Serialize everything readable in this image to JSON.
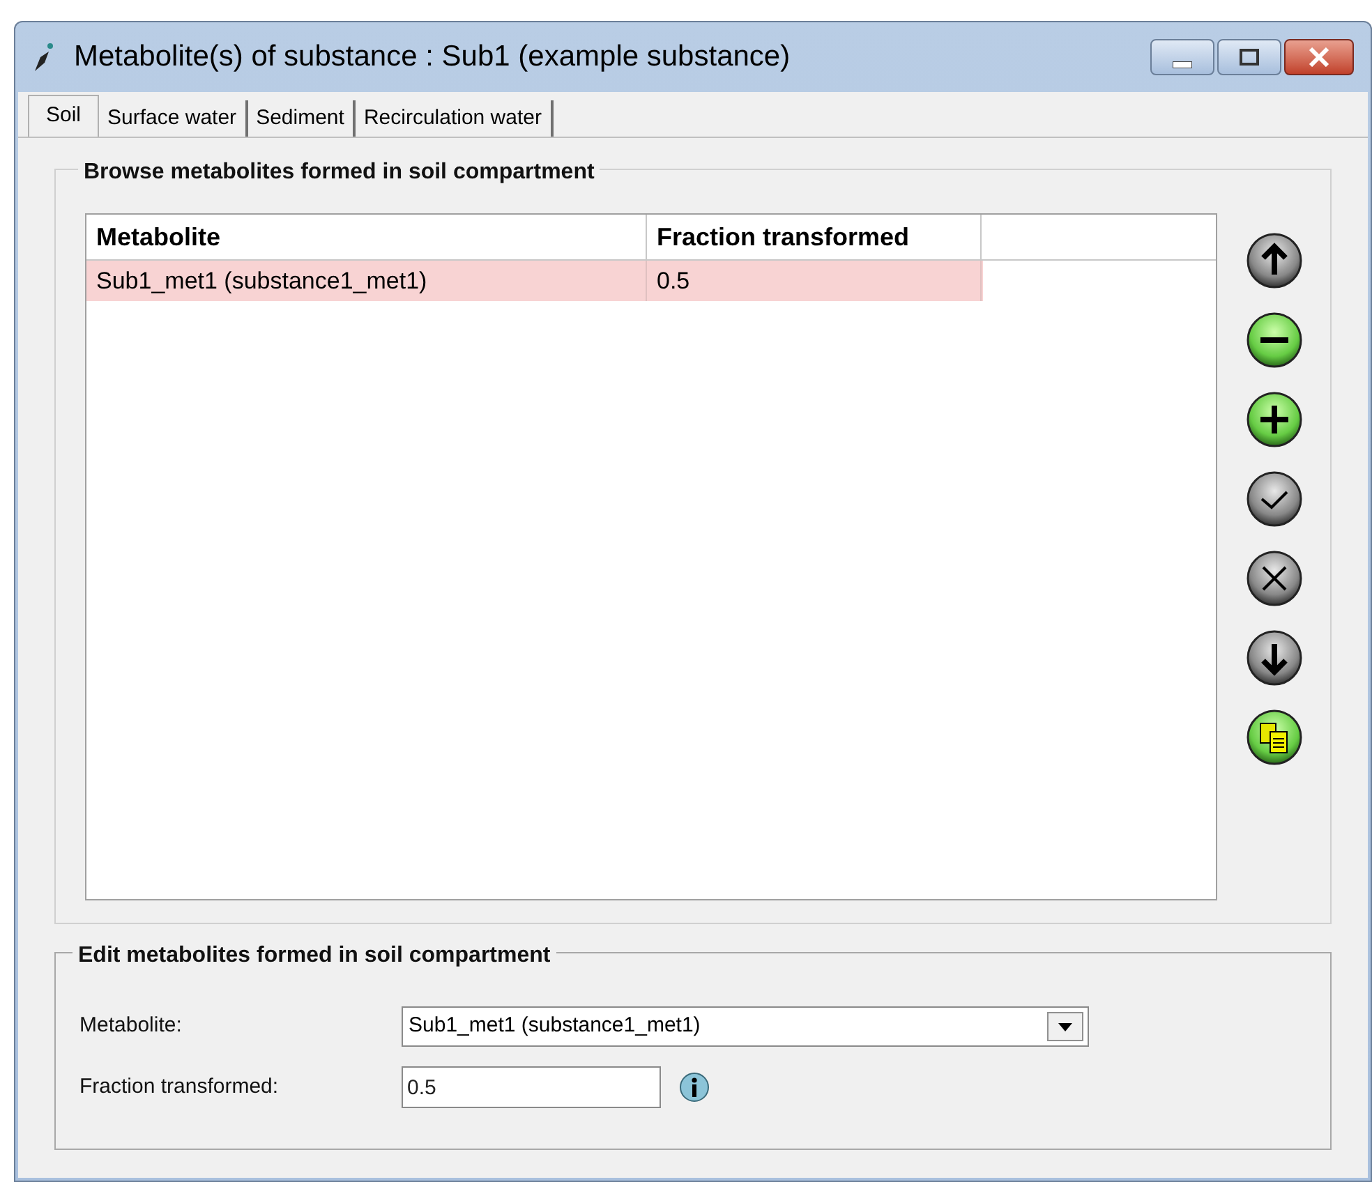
{
  "window": {
    "title": "Metabolite(s) of substance : Sub1 (example substance)"
  },
  "tabs": [
    {
      "label": "Soil",
      "selected": true
    },
    {
      "label": "Surface water",
      "selected": false
    },
    {
      "label": "Sediment",
      "selected": false
    },
    {
      "label": "Recirculation water",
      "selected": false
    }
  ],
  "browse_group": {
    "title": "Browse metabolites formed in soil compartment",
    "table": {
      "columns": [
        "Metabolite",
        "Fraction transformed"
      ],
      "rows": [
        {
          "cells": [
            "Sub1_met1 (substance1_met1)",
            "0.5"
          ],
          "selected": true
        }
      ]
    },
    "toolbar": [
      {
        "kind": "up"
      },
      {
        "kind": "remove"
      },
      {
        "kind": "add"
      },
      {
        "kind": "accept"
      },
      {
        "kind": "cancel"
      },
      {
        "kind": "down"
      },
      {
        "kind": "copy"
      }
    ]
  },
  "edit_group": {
    "title": "Edit metabolites formed in soil compartment",
    "fields": [
      {
        "kind": "dropdown",
        "label": "Metabolite:",
        "value": "Sub1_met1 (substance1_met1)"
      },
      {
        "kind": "text",
        "label": "Fraction transformed:",
        "value": "0.5",
        "info": true
      }
    ]
  }
}
